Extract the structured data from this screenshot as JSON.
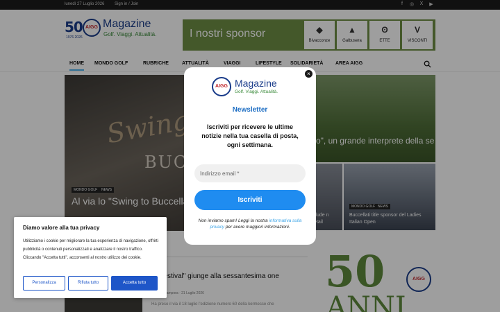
{
  "topbar": {
    "date": "lunedì 27 Luglio 2026",
    "sign_in": "Sign in / Join",
    "social": [
      "f",
      "◎",
      "X",
      "▶"
    ]
  },
  "logo": {
    "number": "50",
    "circle": "AIGG",
    "name": "Magazine",
    "tagline": "Golf. Viaggi. Attualità.",
    "years": "1976 2026"
  },
  "sponsor": {
    "title": "I nostri sponsor",
    "brands": [
      "Bivacconze",
      "Galbusera",
      "ЕТТЕ",
      "VISCONTI"
    ]
  },
  "nav": {
    "items": [
      "HOME",
      "MONDO GOLF",
      "RUBRICHE",
      "ATTUALITÀ",
      "VIAGGI",
      "LIFESTYLE",
      "SOLIDARIETÀ",
      "AREA AIGG"
    ]
  },
  "hero_main": {
    "script_text": "Swing T",
    "brand_text": "BUC",
    "tags": [
      "MONDO GOLF",
      "NEWS"
    ],
    "headline": "Al via lo \"Swing to Buccella Italian Open\""
  },
  "hero_right": {
    "headline": "o\", un grande interprete della se"
  },
  "thumbs": [
    {
      "text": "nclude n Retail"
    },
    {
      "tags": [
        "MONDO GOLF",
        "NEWS"
      ],
      "text": "Buccellati title sponsor del Ladies Italian Open"
    }
  ],
  "article": {
    "title": "\"gofestival\" giunge alla sessantesima one",
    "meta": "a Acampora · 21 Luglio 2026",
    "excerpt": "Ha preso il via il 18 luglio l'edizione numero 60 della kermesse che"
  },
  "sidebar_ad": {
    "number": "50",
    "seal": "AIGG",
    "word": "ANNI"
  },
  "newsletter": {
    "logo_circle": "AIGG",
    "logo_name": "Magazine",
    "logo_tagline": "Golf. Viaggi. Attualità.",
    "title": "Newsletter",
    "description": "Iscriviti per ricevere le ultime notizie nella tua casella di posta, ogni settimana.",
    "email_placeholder": "Indirizzo email *",
    "submit_label": "Iscriviti",
    "privacy_before": "Non inviamo spam! Leggi la nostra ",
    "privacy_link": "informativa sulla privacy",
    "privacy_after": " per avere maggiori informazioni.",
    "close_glyph": "×"
  },
  "cookie": {
    "title": "Diamo valore alla tua privacy",
    "text": "Utilizziamo i cookie per migliorare la tua esperienza di navigazione, offrirti pubblicità o contenuti personalizzati e analizzare il nostro traffico. Cliccando \"Accetta tutti\", acconsenti al nostro utilizzo dei cookie.",
    "customize_label": "Personalizza",
    "reject_label": "Rifiuta tutto",
    "accept_label": "Accetta tutto"
  },
  "colors": {
    "brand_blue": "#1a3c8a",
    "newsletter_title": "#1f6fc4",
    "submit_button": "#1f8cf0",
    "cookie_button": "#1e56c8",
    "nav_active": "#4db2ec",
    "sponsor_bg": "#6f8f45"
  }
}
